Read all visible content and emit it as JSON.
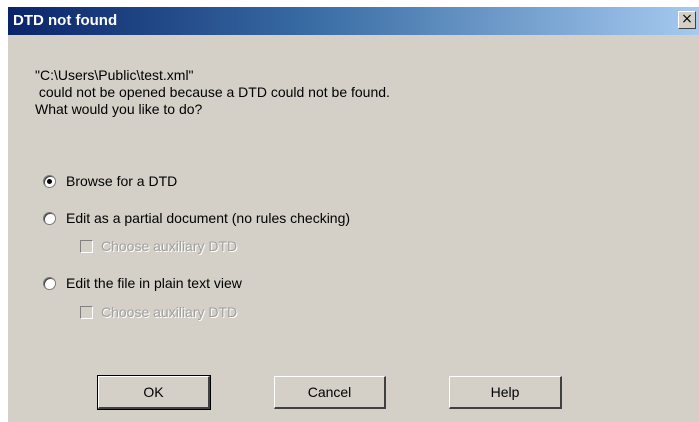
{
  "dialog": {
    "title": "DTD not found",
    "close_glyph": "×",
    "message": [
      "\"C:\\Users\\Public\\test.xml\"",
      " could not be opened because a DTD could not be found.",
      "What would you like to do?"
    ],
    "options": [
      {
        "label": "Browse for a DTD",
        "selected": true
      },
      {
        "label": "Edit as a partial document (no rules checking)",
        "selected": false
      },
      {
        "label": "Edit the file in plain text view",
        "selected": false
      }
    ],
    "sub_options": [
      {
        "label": "Choose auxiliary DTD",
        "enabled": false,
        "checked": false
      },
      {
        "label": "Choose auxiliary DTD",
        "enabled": false,
        "checked": false
      }
    ],
    "buttons": {
      "ok": "OK",
      "cancel": "Cancel",
      "help": "Help"
    }
  }
}
